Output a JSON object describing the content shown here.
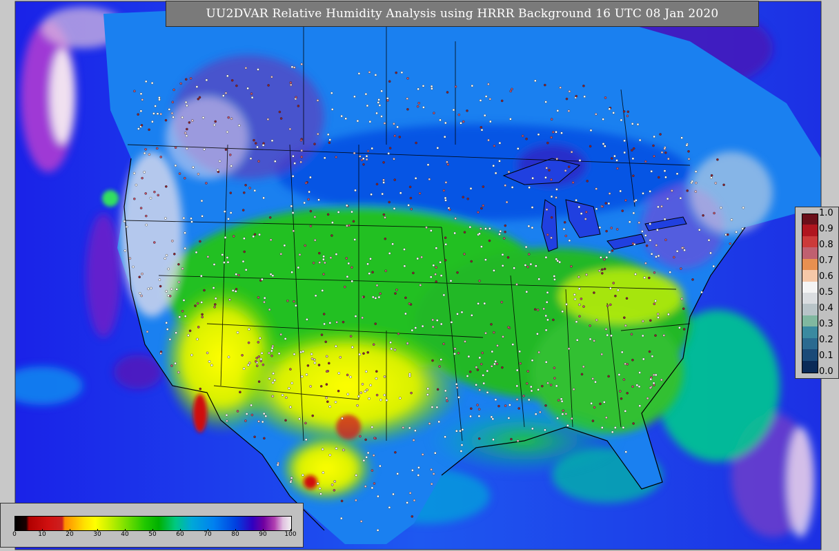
{
  "title": "UU2DVAR Relative Humidity Analysis using HRRR Background 16 UTC 08 Jan 2020",
  "humidity_legend": {
    "ticks": [
      "0",
      "10",
      "20",
      "30",
      "40",
      "50",
      "60",
      "70",
      "80",
      "90",
      "100"
    ],
    "range": [
      0,
      100
    ]
  },
  "ratio_legend": {
    "labels": [
      "1.0",
      "0.9",
      "0.8",
      "0.7",
      "0.6",
      "0.5",
      "0.4",
      "0.3",
      "0.2",
      "0.1",
      "0.0"
    ],
    "colors": [
      "#6b0f1a",
      "#b0151f",
      "#cc3a3a",
      "#c06070",
      "#e89050",
      "#f5c8a8",
      "#f4f4f4",
      "#dadde0",
      "#b8c4c8",
      "#80b8a0",
      "#3a8aa0",
      "#2a6a90",
      "#1a4a78",
      "#0a2a58"
    ]
  },
  "colors": {
    "ocean": "#1a3cf0",
    "land_dry": "#ffff00",
    "land_moist": "#20c020",
    "land_saturated": "#e0e0e0",
    "station_dot": "#ffffff"
  }
}
